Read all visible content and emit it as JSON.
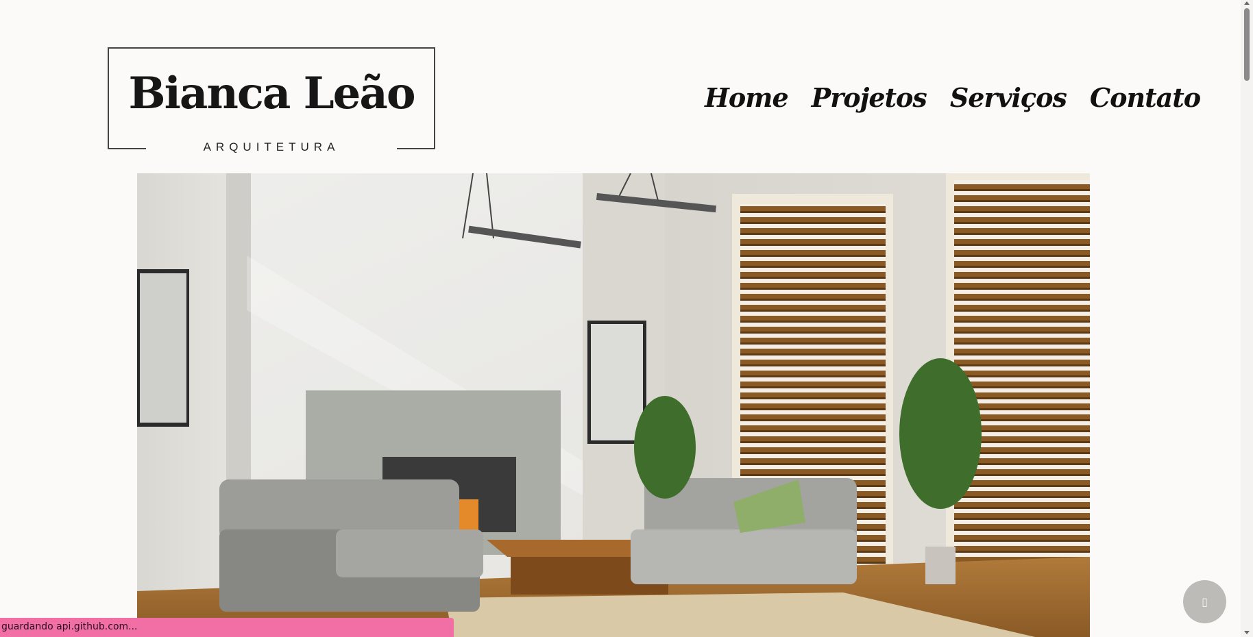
{
  "logo": {
    "name": "Bianca Leão",
    "subtitle": "ARQUITETURA"
  },
  "nav": {
    "items": [
      {
        "label": "Home"
      },
      {
        "label": "Projetos"
      },
      {
        "label": "Serviços"
      },
      {
        "label": "Contato"
      }
    ]
  },
  "hero": {
    "alt": "living-room-interior-photo"
  },
  "float_button": {
    "icon": "chat-icon",
    "glyph": "▯"
  },
  "status": {
    "text": "guardando api.github.com..."
  },
  "colors": {
    "background": "#fbfaf8",
    "status_bar": "#f26fa6",
    "text": "#111111"
  }
}
